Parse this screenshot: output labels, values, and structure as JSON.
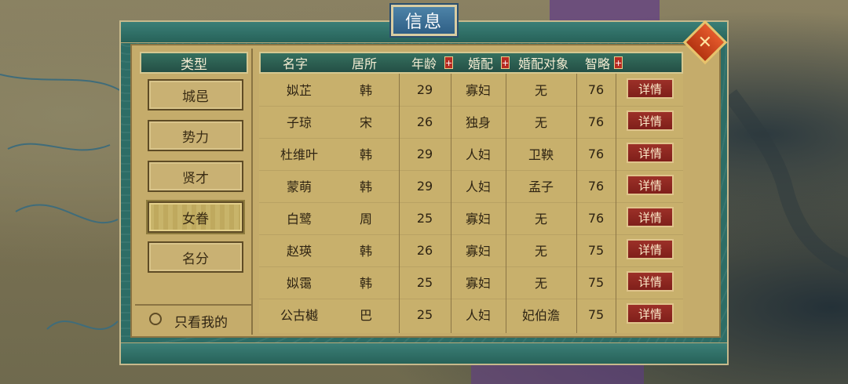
{
  "window": {
    "title": "信息",
    "close_icon": "close-icon"
  },
  "categories": {
    "header": "类型",
    "items": [
      {
        "label": "城邑",
        "active": false
      },
      {
        "label": "势力",
        "active": false
      },
      {
        "label": "贤才",
        "active": false
      },
      {
        "label": "女眷",
        "active": true
      },
      {
        "label": "名分",
        "active": false
      }
    ],
    "only_mine_label": "只看我的"
  },
  "table": {
    "columns": [
      "名字",
      "居所",
      "年龄",
      "婚配",
      "婚配对象",
      "智略"
    ],
    "sort_icon": "+",
    "detail_label": "详情",
    "rows": [
      {
        "name": "姒芷",
        "residence": "韩",
        "age": "29",
        "marital": "寡妇",
        "spouse": "无",
        "wisdom": "76"
      },
      {
        "name": "子琼",
        "residence": "宋",
        "age": "26",
        "marital": "独身",
        "spouse": "无",
        "wisdom": "76"
      },
      {
        "name": "杜维叶",
        "residence": "韩",
        "age": "29",
        "marital": "人妇",
        "spouse": "卫鞅",
        "wisdom": "76"
      },
      {
        "name": "蒙萌",
        "residence": "韩",
        "age": "29",
        "marital": "人妇",
        "spouse": "孟子",
        "wisdom": "76"
      },
      {
        "name": "白鹭",
        "residence": "周",
        "age": "25",
        "marital": "寡妇",
        "spouse": "无",
        "wisdom": "76"
      },
      {
        "name": "赵瑛",
        "residence": "韩",
        "age": "26",
        "marital": "寡妇",
        "spouse": "无",
        "wisdom": "75"
      },
      {
        "name": "姒霭",
        "residence": "韩",
        "age": "25",
        "marital": "寡妇",
        "spouse": "无",
        "wisdom": "75"
      },
      {
        "name": "公古樾",
        "residence": "巴",
        "age": "25",
        "marital": "人妇",
        "spouse": "妃伯澹",
        "wisdom": "75"
      }
    ]
  }
}
